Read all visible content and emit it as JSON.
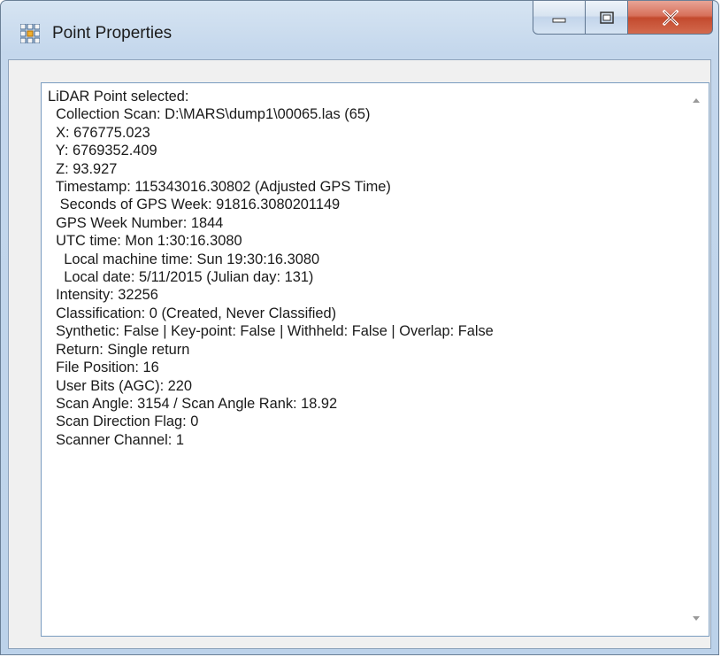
{
  "window": {
    "title": "Point Properties",
    "icon": "grid-app-icon",
    "buttons": [
      "minimize-icon",
      "maximize-icon",
      "close-icon"
    ]
  },
  "textbox": {
    "lines": [
      "LiDAR Point selected:",
      "  Collection Scan: D:\\MARS\\dump1\\00065.las (65)",
      "  X: 676775.023",
      "  Y: 6769352.409",
      "  Z: 93.927",
      "  Timestamp: 115343016.30802 (Adjusted GPS Time)",
      "   Seconds of GPS Week: 91816.3080201149",
      "  GPS Week Number: 1844",
      "  UTC time: Mon 1:30:16.3080",
      "    Local machine time: Sun 19:30:16.3080",
      "    Local date: 5/11/2015 (Julian day: 131)",
      "  Intensity: 32256",
      "  Classification: 0 (Created, Never Classified)",
      "  Synthetic: False | Key-point: False | Withheld: False | Overlap: False",
      "  Return: Single return",
      "  File Position: 16",
      "  User Bits (AGC): 220",
      "  Scan Angle: 3154 / Scan Angle Rank: 18.92",
      "  Scan Direction Flag: 0",
      "  Scanner Channel: 1"
    ]
  },
  "colors": {
    "frame": "#bcd2ea",
    "close_button": "#c34a2e",
    "text": "#1a1a1a"
  }
}
